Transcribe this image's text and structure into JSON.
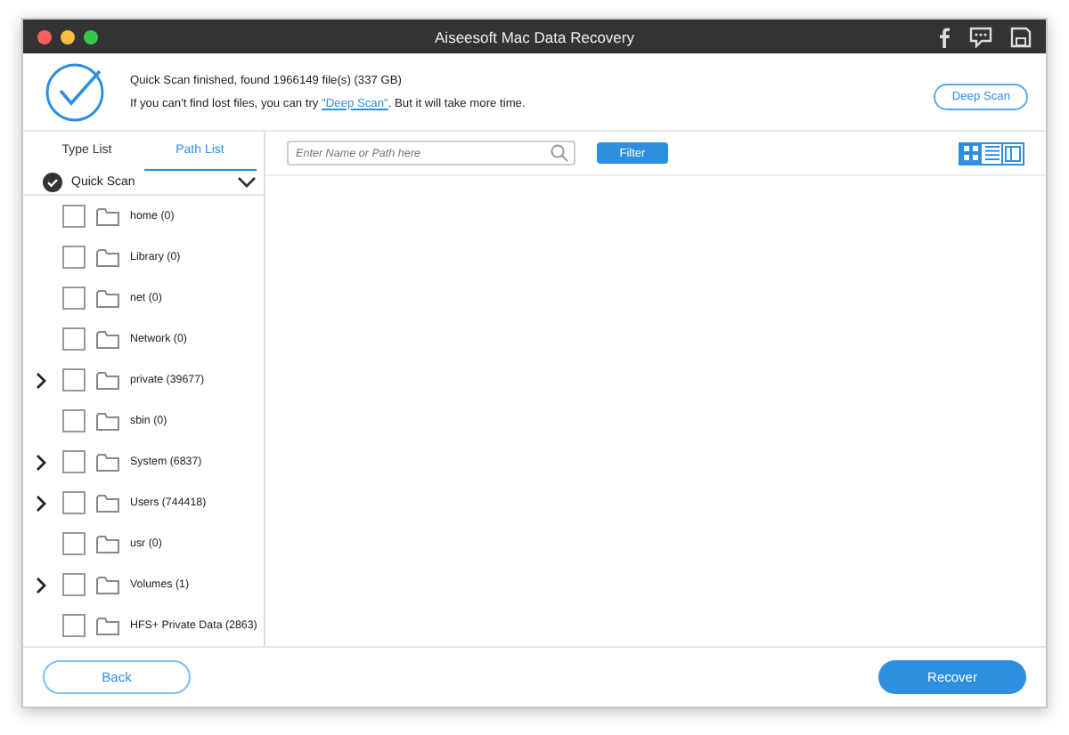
{
  "window": {
    "title": "Aiseesoft Mac Data Recovery"
  },
  "scan": {
    "status": "Quick Scan finished, found 1966149 file(s) (337 GB)",
    "hint_before": "If you can't find lost files, you can try ",
    "hint_link": "\"Deep Scan\"",
    "hint_after": ". But it will take more time.",
    "button": "Deep Scan"
  },
  "tabs": [
    {
      "label": "Type List",
      "selected": false
    },
    {
      "label": "Path List",
      "selected": true
    }
  ],
  "tree": {
    "label": "Quick Scan",
    "checked": true,
    "expanded": true,
    "children": [
      {
        "label": "home (0)",
        "checked": false,
        "expandable": false
      },
      {
        "label": "Library (0)",
        "checked": false,
        "expandable": false
      },
      {
        "label": "net (0)",
        "checked": false,
        "expandable": false
      },
      {
        "label": "Network (0)",
        "checked": false,
        "expandable": false
      },
      {
        "label": "private (39677)",
        "checked": false,
        "expandable": true
      },
      {
        "label": "sbin (0)",
        "checked": false,
        "expandable": false
      },
      {
        "label": "System (6837)",
        "checked": false,
        "expandable": true
      },
      {
        "label": "Users (744418)",
        "checked": false,
        "expandable": true
      },
      {
        "label": "usr (0)",
        "checked": false,
        "expandable": false
      },
      {
        "label": "Volumes (1)",
        "checked": false,
        "expandable": true
      },
      {
        "label": "HFS+ Private Data (2863)",
        "checked": false,
        "expandable": false
      }
    ]
  },
  "search": {
    "placeholder": "Enter Name or Path here"
  },
  "filter_button": "Filter",
  "views": [
    {
      "kind": "grid",
      "selected": true
    },
    {
      "kind": "list",
      "selected": false
    },
    {
      "kind": "columns",
      "selected": false
    }
  ],
  "footer": {
    "back": "Back",
    "recover": "Recover"
  }
}
